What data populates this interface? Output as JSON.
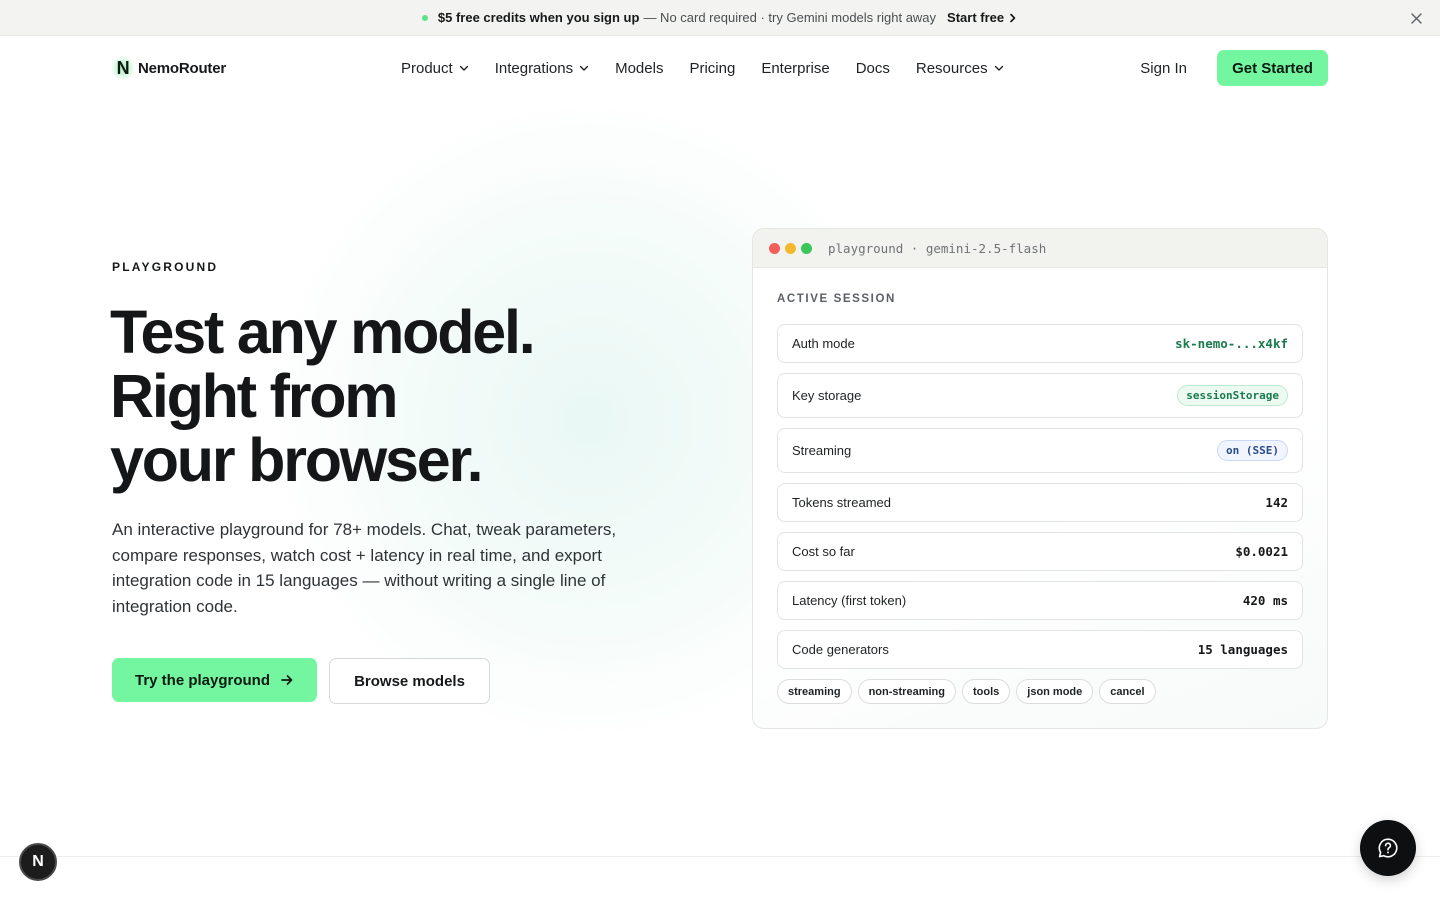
{
  "announcement": {
    "highlight": "$5 free credits when you sign up",
    "rest": "— No card required · try Gemini models right away",
    "cta": "Start free"
  },
  "nav": {
    "logo_letter": "N",
    "logo_text": "NemoRouter",
    "links": [
      "Product",
      "Integrations",
      "Models",
      "Pricing",
      "Enterprise",
      "Docs",
      "Resources"
    ],
    "sign_in": "Sign In",
    "get_started": "Get Started"
  },
  "hero": {
    "eyebrow": "PLAYGROUND",
    "title_lines": [
      "Test any model.",
      "Right from",
      "your browser."
    ],
    "description": "An interactive playground for 78+ models. Chat, tweak parameters, compare responses, watch cost + latency in real time, and export integration code in 15 languages — without writing a single line of integration code.",
    "primary_button": "Try the playground",
    "secondary_button": "Browse models"
  },
  "card": {
    "title": "playground · gemini-2.5-flash",
    "section_label": "ACTIVE SESSION",
    "rows": [
      {
        "label": "Auth mode",
        "value": "sk-nemo-...x4kf"
      },
      {
        "label": "Key storage",
        "value": "sessionStorage"
      },
      {
        "label": "Streaming",
        "value": "on (SSE)"
      },
      {
        "label": "Tokens streamed",
        "value": "142"
      },
      {
        "label": "Cost so far",
        "value": "$0.0021"
      },
      {
        "label": "Latency (first token)",
        "value": "420 ms"
      },
      {
        "label": "Code generators",
        "value": "15 languages"
      }
    ],
    "tags": [
      "streaming",
      "non-streaming",
      "tools",
      "json mode",
      "cancel"
    ]
  },
  "footer_badge": "N",
  "colors": {
    "accent": "#74f5a0",
    "text": "#16181a",
    "card_border": "#e4e6e2"
  }
}
